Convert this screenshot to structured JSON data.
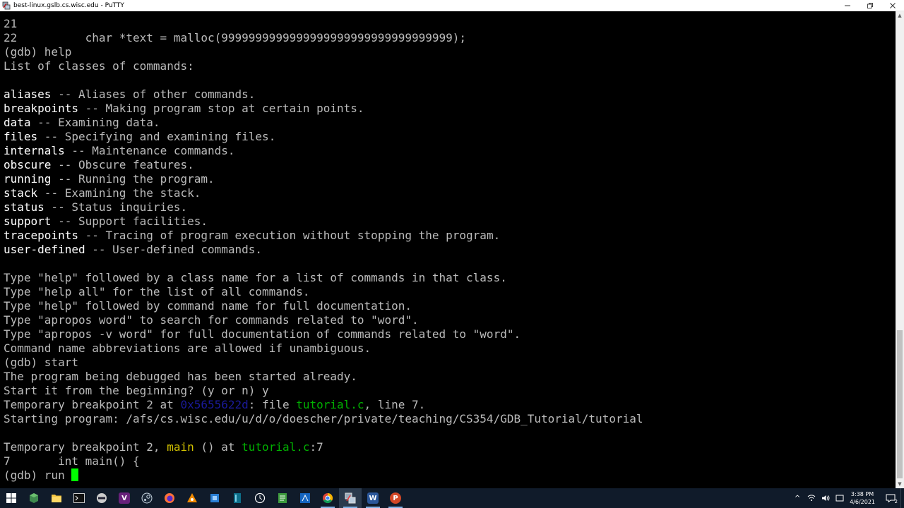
{
  "window": {
    "title": "best-linux.gslb.cs.wisc.edu - PuTTY"
  },
  "colors": {
    "terminal_bg": "#000000",
    "terminal_fg": "#bbbbbb",
    "command_fg": "#ffffff",
    "address_fg": "#1a1a9a",
    "file_fg": "#00b000",
    "function_fg": "#d2c200",
    "cursor": "#00ff00",
    "taskbar_bg": "#101b2a"
  },
  "terminal": {
    "lines": [
      [
        {
          "t": "21",
          "c": ""
        }
      ],
      [
        {
          "t": "22          char *text = malloc(9999999999999999999999999999999999);",
          "c": ""
        }
      ],
      [
        {
          "t": "(gdb) help",
          "c": ""
        }
      ],
      [
        {
          "t": "List of classes of commands:",
          "c": ""
        }
      ],
      [
        {
          "t": "",
          "c": ""
        }
      ],
      [
        {
          "t": "aliases",
          "c": "cmd"
        },
        {
          "t": " -- Aliases of other commands.",
          "c": ""
        }
      ],
      [
        {
          "t": "breakpoints",
          "c": "cmd"
        },
        {
          "t": " -- Making program stop at certain points.",
          "c": ""
        }
      ],
      [
        {
          "t": "data",
          "c": "cmd"
        },
        {
          "t": " -- Examining data.",
          "c": ""
        }
      ],
      [
        {
          "t": "files",
          "c": "cmd"
        },
        {
          "t": " -- Specifying and examining files.",
          "c": ""
        }
      ],
      [
        {
          "t": "internals",
          "c": "cmd"
        },
        {
          "t": " -- Maintenance commands.",
          "c": ""
        }
      ],
      [
        {
          "t": "obscure",
          "c": "cmd"
        },
        {
          "t": " -- Obscure features.",
          "c": ""
        }
      ],
      [
        {
          "t": "running",
          "c": "cmd"
        },
        {
          "t": " -- Running the program.",
          "c": ""
        }
      ],
      [
        {
          "t": "stack",
          "c": "cmd"
        },
        {
          "t": " -- Examining the stack.",
          "c": ""
        }
      ],
      [
        {
          "t": "status",
          "c": "cmd"
        },
        {
          "t": " -- Status inquiries.",
          "c": ""
        }
      ],
      [
        {
          "t": "support",
          "c": "cmd"
        },
        {
          "t": " -- Support facilities.",
          "c": ""
        }
      ],
      [
        {
          "t": "tracepoints",
          "c": "cmd"
        },
        {
          "t": " -- Tracing of program execution without stopping the program.",
          "c": ""
        }
      ],
      [
        {
          "t": "user-defined",
          "c": "cmd"
        },
        {
          "t": " -- User-defined commands.",
          "c": ""
        }
      ],
      [
        {
          "t": "",
          "c": ""
        }
      ],
      [
        {
          "t": "Type \"help\" followed by a class name for a list of commands in that class.",
          "c": ""
        }
      ],
      [
        {
          "t": "Type \"help all\" for the list of all commands.",
          "c": ""
        }
      ],
      [
        {
          "t": "Type \"help\" followed by command name for full documentation.",
          "c": ""
        }
      ],
      [
        {
          "t": "Type \"apropos word\" to search for commands related to \"word\".",
          "c": ""
        }
      ],
      [
        {
          "t": "Type \"apropos -v word\" for full documentation of commands related to \"word\".",
          "c": ""
        }
      ],
      [
        {
          "t": "Command name abbreviations are allowed if unambiguous.",
          "c": ""
        }
      ],
      [
        {
          "t": "(gdb) start",
          "c": ""
        }
      ],
      [
        {
          "t": "The program being debugged has been started already.",
          "c": ""
        }
      ],
      [
        {
          "t": "Start it from the beginning? (y or n) y",
          "c": ""
        }
      ],
      [
        {
          "t": "Temporary breakpoint 2 at ",
          "c": ""
        },
        {
          "t": "0x5655622d",
          "c": "addr"
        },
        {
          "t": ": file ",
          "c": ""
        },
        {
          "t": "tutorial.c",
          "c": "file"
        },
        {
          "t": ", line 7.",
          "c": ""
        }
      ],
      [
        {
          "t": "Starting program: /afs/cs.wisc.edu/u/d/o/doescher/private/teaching/CS354/GDB_Tutorial/tutorial",
          "c": ""
        }
      ],
      [
        {
          "t": "",
          "c": ""
        }
      ],
      [
        {
          "t": "Temporary breakpoint 2, ",
          "c": ""
        },
        {
          "t": "main",
          "c": "func"
        },
        {
          "t": " () at ",
          "c": ""
        },
        {
          "t": "tutorial.c",
          "c": "file"
        },
        {
          "t": ":7",
          "c": ""
        }
      ],
      [
        {
          "t": "7       int main() {",
          "c": ""
        }
      ],
      [
        {
          "t": "(gdb) run ",
          "c": ""
        },
        {
          "t": "",
          "c": "cursor"
        }
      ]
    ]
  },
  "taskbar": {
    "clock_time": "3:38 PM",
    "clock_date": "4/6/2021",
    "notification_count": "2",
    "apps": [
      {
        "name": "start-button-icon"
      },
      {
        "name": "app-cube-icon"
      },
      {
        "name": "file-explorer-icon"
      },
      {
        "name": "terminal-icon"
      },
      {
        "name": "vpn-icon"
      },
      {
        "name": "visual-studio-icon"
      },
      {
        "name": "steam-icon"
      },
      {
        "name": "firefox-icon"
      },
      {
        "name": "app-orange-icon"
      },
      {
        "name": "app-blue-icon"
      },
      {
        "name": "app-teal-icon"
      },
      {
        "name": "clock-app-icon"
      },
      {
        "name": "notepad-icon"
      },
      {
        "name": "app-blue-square-icon"
      },
      {
        "name": "chrome-icon"
      },
      {
        "name": "putty-icon"
      },
      {
        "name": "word-icon"
      },
      {
        "name": "powerpoint-icon"
      }
    ]
  }
}
